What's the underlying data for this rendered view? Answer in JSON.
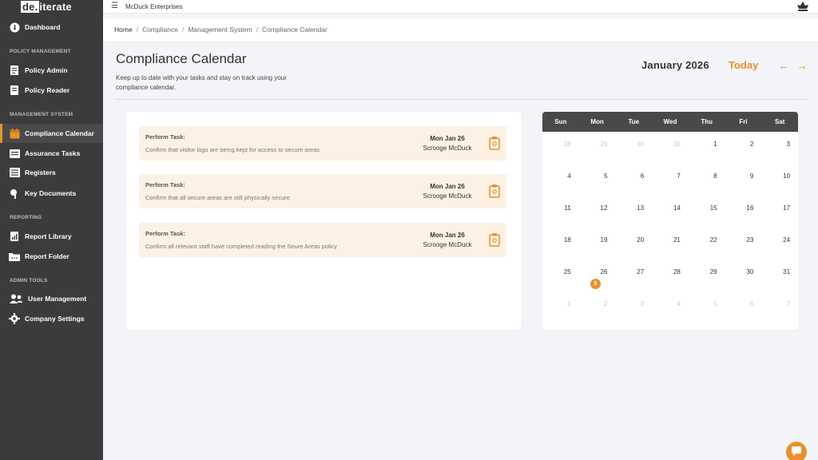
{
  "app": {
    "logo_box": "de.",
    "logo_rest": "iterate",
    "company": "McDuck Enterprises"
  },
  "sidebar": {
    "dashboard": "Dashboard",
    "sections": {
      "policy": "POLICY MANAGEMENT",
      "management": "MANAGEMENT SYSTEM",
      "reporting": "REPORTING",
      "admin": "ADMIN TOOLS"
    },
    "items": [
      {
        "label": "Policy Admin",
        "icon": "policy-admin-icon"
      },
      {
        "label": "Policy Reader",
        "icon": "policy-reader-icon"
      },
      {
        "label": "Compliance Calendar",
        "icon": "calendar-icon"
      },
      {
        "label": "Assurance Tasks",
        "icon": "tasks-icon"
      },
      {
        "label": "Registers",
        "icon": "registers-icon"
      },
      {
        "label": "Key Documents",
        "icon": "key-documents-icon"
      },
      {
        "label": "Report Library",
        "icon": "report-library-icon"
      },
      {
        "label": "Report Folder",
        "icon": "report-folder-icon"
      },
      {
        "label": "User Management",
        "icon": "users-icon"
      },
      {
        "label": "Company Settings",
        "icon": "gear-icon"
      }
    ],
    "active": "Compliance Calendar"
  },
  "breadcrumb": [
    "Home",
    "Compliance",
    "Management System",
    "Compliance Calendar"
  ],
  "header": {
    "title": "Compliance Calendar",
    "subtitle": "Keep up to date with your tasks and stay on track using your compliance calendar.",
    "month": "January 2026",
    "today": "Today",
    "prev": "←",
    "next": "→"
  },
  "tasks": [
    {
      "label": "Perform Task:",
      "desc": "Confirm that visitor logs are being kept for access to secure areas",
      "date": "Mon Jan 26",
      "user": "Scrooge McDuck"
    },
    {
      "label": "Perform Task:",
      "desc": "Confirm that all secure areas are still physically secure",
      "date": "Mon Jan 26",
      "user": "Scrooge McDuck"
    },
    {
      "label": "Perform Task:",
      "desc": "Confirm all relevant staff have completed reading the Seure Areas policy",
      "date": "Mon Jan 26",
      "user": "Scrooge McDuck"
    }
  ],
  "calendar": {
    "weekdays": [
      "Sun",
      "Mon",
      "Tue",
      "Wed",
      "Thu",
      "Fri",
      "Sat"
    ],
    "weeks": [
      [
        "28",
        "29",
        "30",
        "31",
        "1",
        "2",
        "3"
      ],
      [
        "4",
        "5",
        "6",
        "7",
        "8",
        "9",
        "10"
      ],
      [
        "11",
        "12",
        "13",
        "14",
        "15",
        "16",
        "17"
      ],
      [
        "18",
        "19",
        "20",
        "21",
        "22",
        "23",
        "24"
      ],
      [
        "25",
        "26",
        "27",
        "28",
        "29",
        "30",
        "31"
      ],
      [
        "1",
        "2",
        "3",
        "4",
        "5",
        "6",
        "7"
      ]
    ],
    "other_month": [
      [
        true,
        true,
        true,
        true,
        false,
        false,
        false
      ],
      [
        false,
        false,
        false,
        false,
        false,
        false,
        false
      ],
      [
        false,
        false,
        false,
        false,
        false,
        false,
        false
      ],
      [
        false,
        false,
        false,
        false,
        false,
        false,
        false
      ],
      [
        false,
        false,
        false,
        false,
        false,
        false,
        false
      ],
      [
        true,
        true,
        true,
        true,
        true,
        true,
        true
      ]
    ],
    "badge_day": "26",
    "badge_count": "3"
  },
  "colors": {
    "accent": "#e8912e",
    "sidebar": "#3b3b3b",
    "task_bg": "#fdf1e4"
  }
}
